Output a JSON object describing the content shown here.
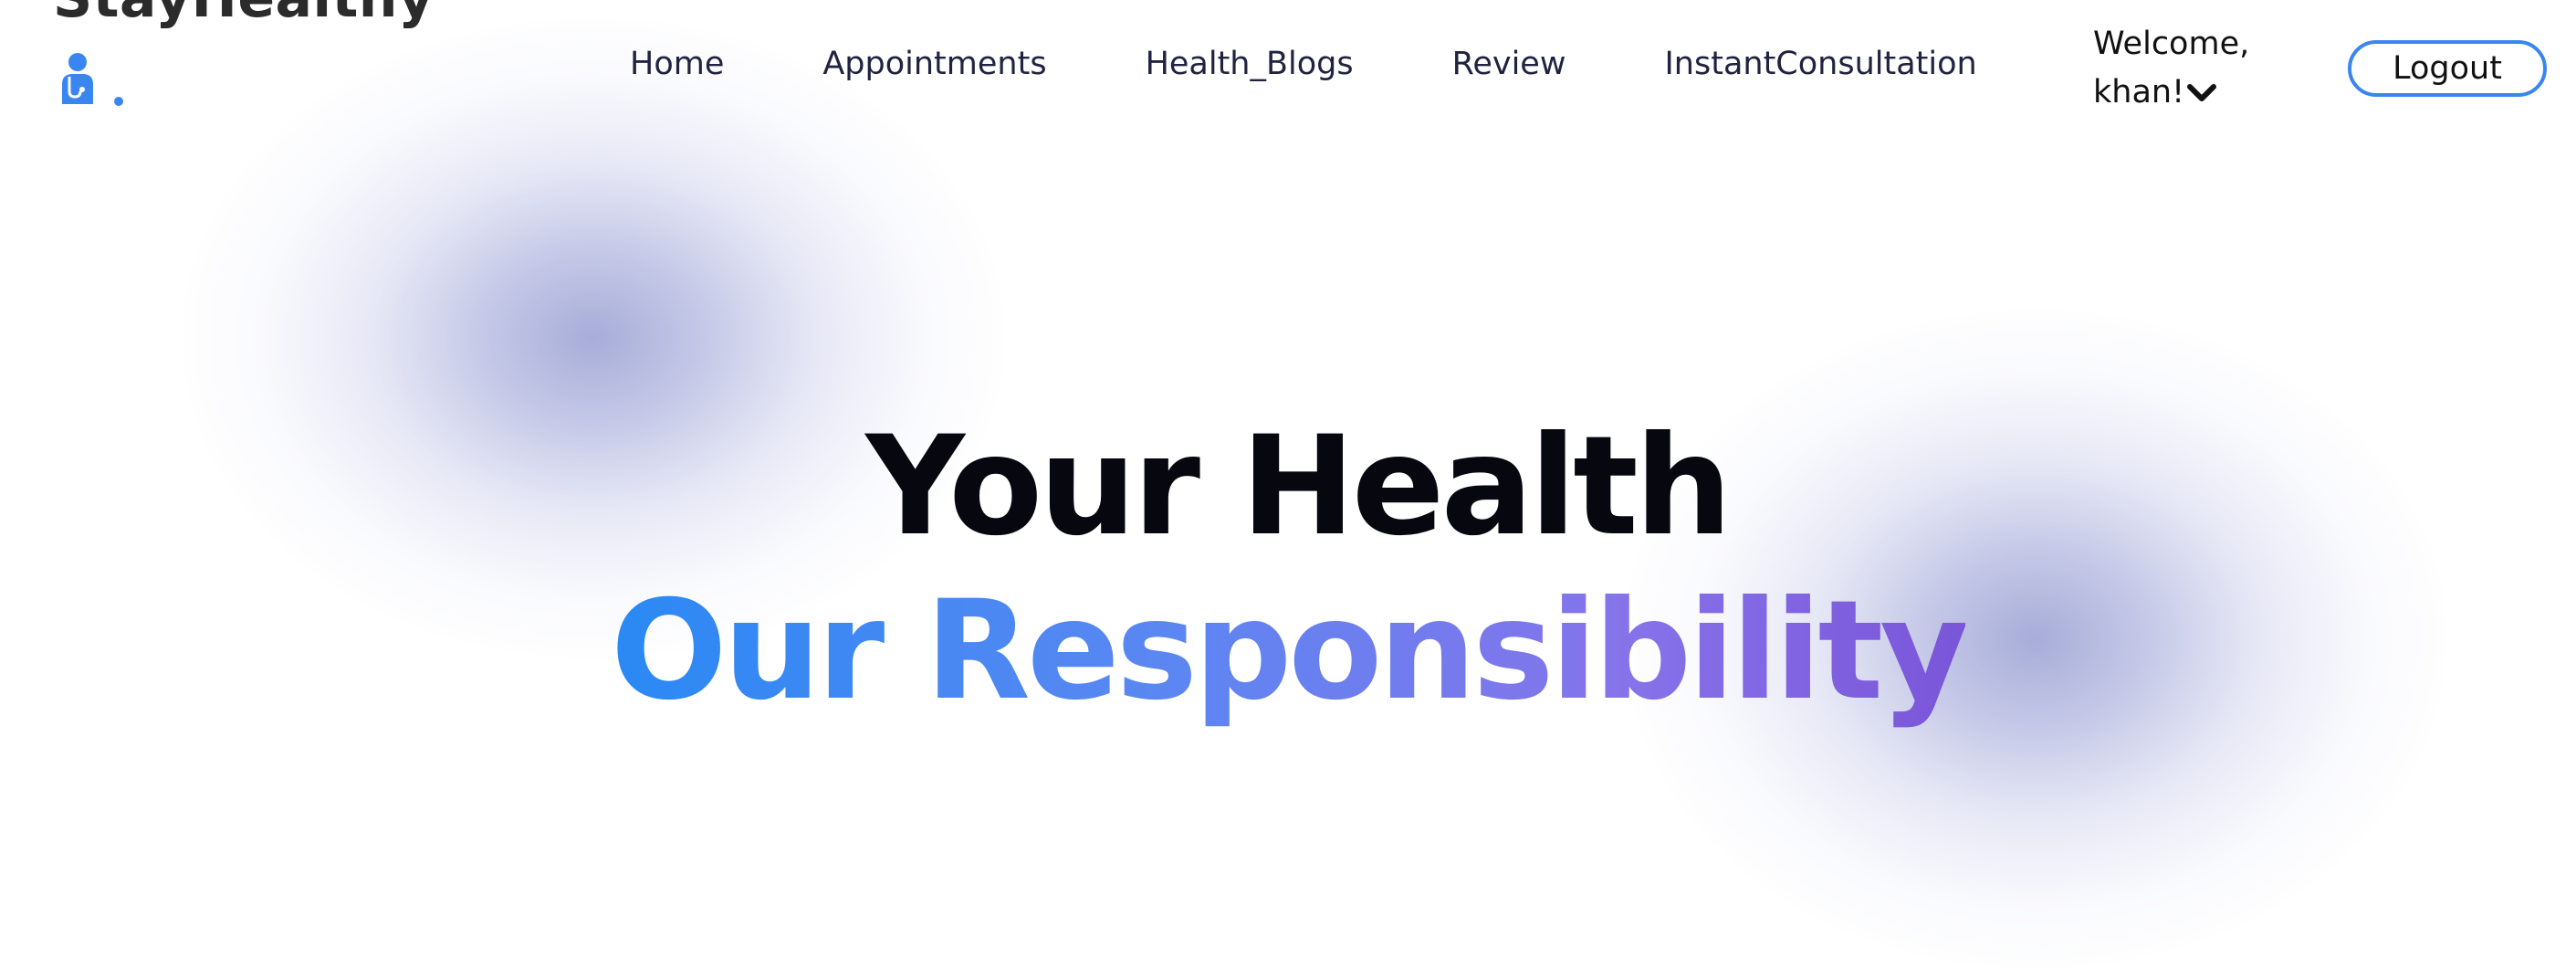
{
  "brand": {
    "name": "StayHealthy",
    "icon": "doctor-stethoscope-icon",
    "accent_color": "#3a86f0"
  },
  "nav": {
    "links": [
      {
        "label": "Home"
      },
      {
        "label": "Appointments"
      },
      {
        "label": "Health_Blogs"
      },
      {
        "label": "Review"
      },
      {
        "label": "InstantConsultation"
      }
    ]
  },
  "user": {
    "welcome_line1": "Welcome,",
    "welcome_line2": "khan!",
    "dropdown_icon": "chevron-down-icon",
    "logout_label": "Logout"
  },
  "hero": {
    "line1": "Your Health",
    "line2": "Our Responsibility",
    "line1_color": "#06070f",
    "line2_gradient": [
      "#2a89f4",
      "#5a87f2",
      "#8673ea",
      "#7a55d8"
    ]
  }
}
